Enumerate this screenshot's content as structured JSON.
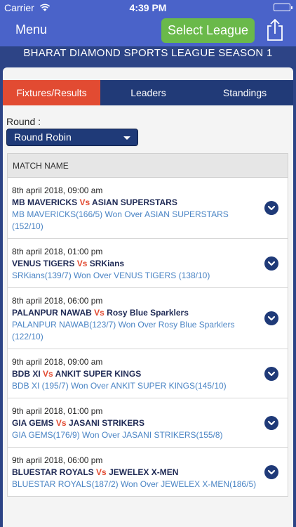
{
  "status": {
    "carrier": "Carrier",
    "time": "4:39 PM"
  },
  "nav": {
    "menu_label": "Menu",
    "select_league_label": "Select League"
  },
  "league_title": "BHARAT DIAMOND SPORTS LEAGUE SEASON 1",
  "tabs": [
    {
      "label": "Fixtures/Results",
      "active": true
    },
    {
      "label": "Leaders",
      "active": false
    },
    {
      "label": "Standings",
      "active": false
    }
  ],
  "round": {
    "label": "Round :",
    "selected": "Round Robin"
  },
  "table": {
    "header": "MATCH NAME"
  },
  "matches": [
    {
      "date": "8th april 2018, 09:00 am",
      "team1": "MB MAVERICKS",
      "vs": "Vs",
      "team2": "ASIAN SUPERSTARS",
      "result": "MB MAVERICKS(166/5) Won Over ASIAN SUPERSTARS (152/10)"
    },
    {
      "date": "8th april 2018, 01:00 pm",
      "team1": "VENUS TIGERS",
      "vs": "Vs",
      "team2": "SRKians",
      "result": "SRKians(139/7) Won Over VENUS TIGERS (138/10)"
    },
    {
      "date": "8th april 2018, 06:00 pm",
      "team1": "PALANPUR NAWAB",
      "vs": "Vs",
      "team2": "Rosy Blue Sparklers",
      "result": "PALANPUR NAWAB(123/7) Won Over Rosy Blue Sparklers (122/10)"
    },
    {
      "date": "9th april 2018, 09:00 am",
      "team1": "BDB XI",
      "vs": "Vs",
      "team2": "ANKIT SUPER KINGS",
      "result": "BDB XI (195/7) Won Over ANKIT SUPER KINGS(145/10)"
    },
    {
      "date": "9th april 2018, 01:00 pm",
      "team1": "GIA GEMS",
      "vs": "Vs",
      "team2": "JASANI STRIKERS",
      "result": "GIA GEMS(176/9) Won Over JASANI STRIKERS(155/8)"
    },
    {
      "date": "9th april 2018, 06:00 pm",
      "team1": "BLUESTAR ROYALS",
      "vs": "Vs",
      "team2": "JEWELEX X-MEN",
      "result": "BLUESTAR ROYALS(187/2) Won Over JEWELEX X-MEN(186/5)"
    }
  ],
  "colors": {
    "nav": "#4a63c9",
    "accent": "#e24b32",
    "league_button": "#6ab94a",
    "dark_blue": "#213a77",
    "result_text": "#4a84c4"
  }
}
